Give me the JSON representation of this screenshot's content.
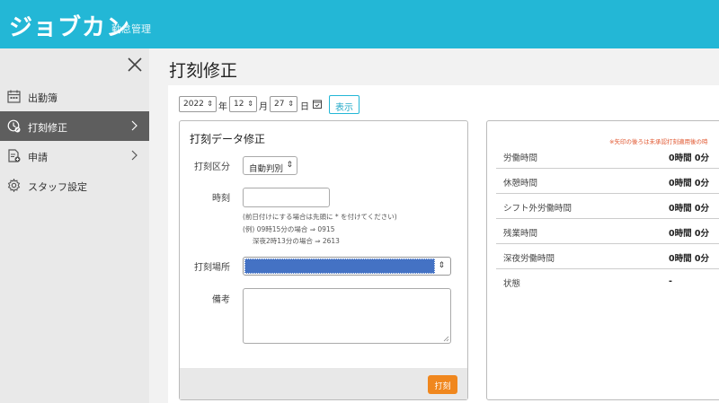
{
  "header": {
    "brand": "ジョブカン",
    "brand_sub": "勤怠管理"
  },
  "sidebar": {
    "items": [
      {
        "label": "出勤簿",
        "icon": "calendar-icon",
        "active": false
      },
      {
        "label": "打刻修正",
        "icon": "clock-edit-icon",
        "active": true
      },
      {
        "label": "申請",
        "icon": "document-icon",
        "active": false
      },
      {
        "label": "スタッフ設定",
        "icon": "gear-icon",
        "active": false
      }
    ]
  },
  "page": {
    "title": "打刻修正"
  },
  "date_picker": {
    "year": "2022",
    "year_unit": "年",
    "month": "12",
    "month_unit": "月",
    "day": "27",
    "day_unit": "日",
    "show_label": "表示"
  },
  "punch_form": {
    "title": "打刻データ修正",
    "type_label": "打刻区分",
    "type_value": "自動判別",
    "time_label": "時刻",
    "time_value": "",
    "hint1": "(前日付けにする場合は先頭に * を付けてください)",
    "hint2": "(例) 09時15分の場合 ⇒ 0915",
    "hint3": "深夜2時13分の場合 ⇒ 2613",
    "place_label": "打刻場所",
    "place_value": "",
    "note_label": "備考",
    "note_value": "",
    "submit_label": "打刻"
  },
  "summary": {
    "note": "※矢印の後ろは未承認打刻適用後の時",
    "rows": [
      {
        "label": "労働時間",
        "value": "0時間 0分"
      },
      {
        "label": "休憩時間",
        "value": "0時間 0分"
      },
      {
        "label": "シフト外労働時間",
        "value": "0時間 0分"
      },
      {
        "label": "残業時間",
        "value": "0時間 0分"
      },
      {
        "label": "深夜労働時間",
        "value": "0時間 0分"
      },
      {
        "label": "状態",
        "value": "-"
      }
    ]
  },
  "colors": {
    "accent": "#23b7d6",
    "submit": "#f0871e",
    "selected": "#4472c4"
  }
}
